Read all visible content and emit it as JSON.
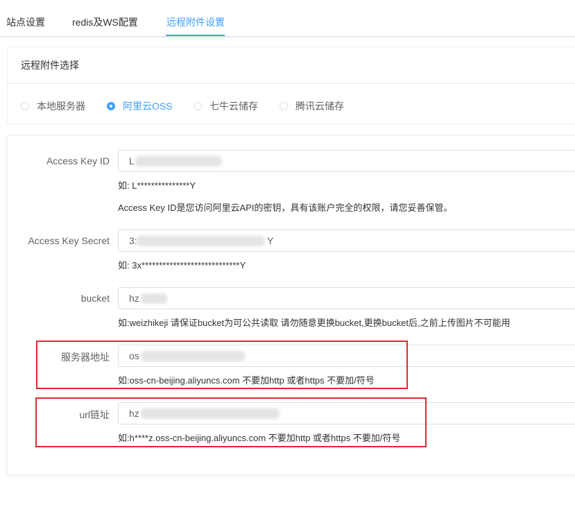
{
  "tabs": [
    {
      "label": "站点设置"
    },
    {
      "label": "redis及WS配置"
    },
    {
      "label": "远程附件设置"
    }
  ],
  "remote_select": {
    "title": "远程附件选择",
    "options": [
      {
        "label": "本地服务器",
        "checked": false
      },
      {
        "label": "阿里云OSS",
        "checked": true
      },
      {
        "label": "七牛云储存",
        "checked": false
      },
      {
        "label": "腾讯云储存",
        "checked": false
      }
    ]
  },
  "form": {
    "access_key_id": {
      "label": "Access Key ID",
      "value_prefix": "L",
      "hint": "如: L***************Y",
      "desc": "Access Key ID是您访问阿里云API的密钥，具有该账户完全的权限，请您妥善保管。"
    },
    "access_key_secret": {
      "label": "Access Key Secret",
      "value_prefix": "3:",
      "value_suffix": "Y",
      "hint": "如: 3x****************************Y"
    },
    "bucket": {
      "label": "bucket",
      "value_prefix": "hz",
      "hint": "如:weizhikeji 请保证bucket为可公共读取 请勿随意更换bucket,更换bucket后,之前上传图片不可能用"
    },
    "server_address": {
      "label": "服务器地址",
      "value_prefix": "os",
      "hint": "如:oss-cn-beijing.aliyuncs.com 不要加http 或者https 不要加/符号"
    },
    "url_domain": {
      "label": "url链址",
      "value_prefix": "hz",
      "hint": "如:h****z.oss-cn-beijing.aliyuncs.com 不要加http 或者https 不要加/符号"
    }
  },
  "colors": {
    "accent": "#409eff",
    "highlight_box": "#e0282e"
  }
}
